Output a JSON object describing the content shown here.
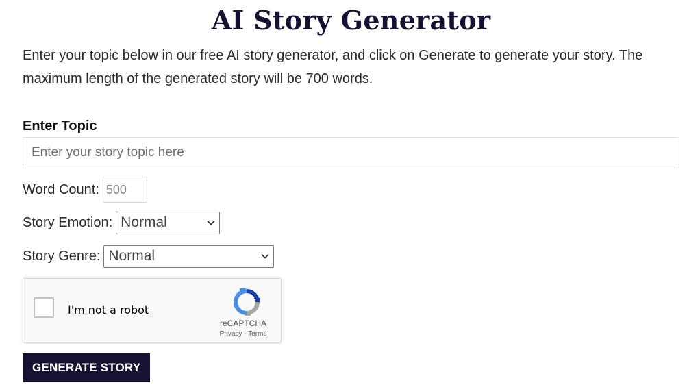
{
  "page": {
    "title": "AI Story Generator",
    "intro": "Enter your topic below in our free AI story generator, and click on Generate to generate your story. The maximum length of the generated story will be 700 words."
  },
  "form": {
    "topic_label": "Enter Topic",
    "topic_placeholder": "Enter your story topic here",
    "word_count_label": "Word Count:",
    "word_count_placeholder": "500",
    "emotion_label": "Story Emotion:",
    "emotion_selected": "Normal",
    "genre_label": "Story Genre:",
    "genre_selected": "Normal",
    "generate_label": "GENERATE STORY"
  },
  "captcha": {
    "label": "I'm not a robot",
    "brand": "reCAPTCHA",
    "privacy": "Privacy",
    "separator": " - ",
    "terms": "Terms",
    "icon": "recaptcha-logo-icon"
  },
  "colors": {
    "brand_navy": "#151232",
    "text": "#2a2a2a",
    "button_text": "#ffffff",
    "captcha_blue": "#4a90e2",
    "captcha_dark_blue": "#1c3aa9",
    "captcha_gray": "#a6a6a6"
  }
}
